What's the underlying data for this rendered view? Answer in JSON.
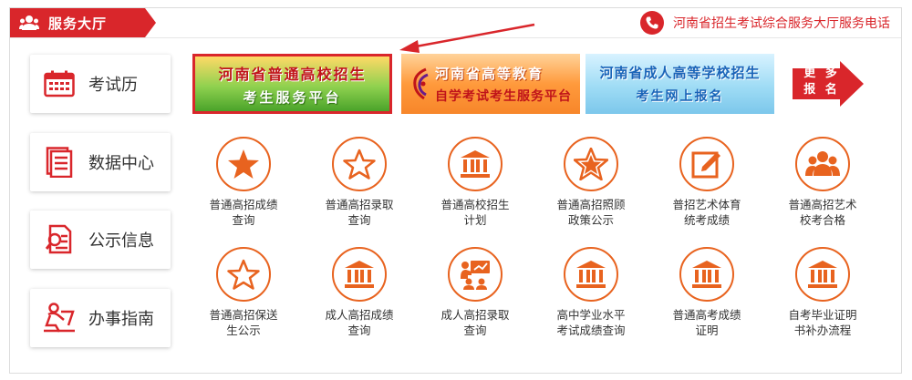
{
  "header": {
    "title": "服务大厅",
    "hotline": "河南省招生考试综合服务大厅服务电话"
  },
  "sidebar": {
    "items": [
      {
        "label": "考试历"
      },
      {
        "label": "数据中心"
      },
      {
        "label": "公示信息"
      },
      {
        "label": "办事指南"
      }
    ]
  },
  "banners": {
    "b1": {
      "line1": "河南省普通高校招生",
      "line2": "考生服务平台"
    },
    "b2": {
      "line1": "河南省高等教育",
      "line2": "自学考试考生服务平台"
    },
    "b3": {
      "line1": "河南省成人高等学校招生",
      "line2": "考生网上报名"
    },
    "more": {
      "line1": "更 多",
      "line2": "报 名"
    }
  },
  "services": [
    {
      "line1": "普通高招成绩",
      "line2": "查询",
      "icon": "star-filled-icon"
    },
    {
      "line1": "普通高招录取",
      "line2": "查询",
      "icon": "star-outline-icon"
    },
    {
      "line1": "普通高校招生",
      "line2": "计划",
      "icon": "building-icon"
    },
    {
      "line1": "普通高招照顾",
      "line2": "政策公示",
      "icon": "star-badge-icon"
    },
    {
      "line1": "普招艺术体育",
      "line2": "统考成绩",
      "icon": "edit-icon"
    },
    {
      "line1": "普通高招艺术",
      "line2": "校考合格",
      "icon": "people-icon"
    },
    {
      "line1": "普通高招保送",
      "line2": "生公示",
      "icon": "star-outline-icon"
    },
    {
      "line1": "成人高招成绩",
      "line2": "查询",
      "icon": "building-icon"
    },
    {
      "line1": "成人高招录取",
      "line2": "查询",
      "icon": "presentation-icon"
    },
    {
      "line1": "高中学业水平",
      "line2": "考试成绩查询",
      "icon": "building-icon"
    },
    {
      "line1": "普通高考成绩",
      "line2": "证明",
      "icon": "building-icon"
    },
    {
      "line1": "自考毕业证明",
      "line2": "书补办流程",
      "icon": "building-icon"
    }
  ],
  "colors": {
    "accent": "#d9262b",
    "icon": "#e8631f"
  }
}
